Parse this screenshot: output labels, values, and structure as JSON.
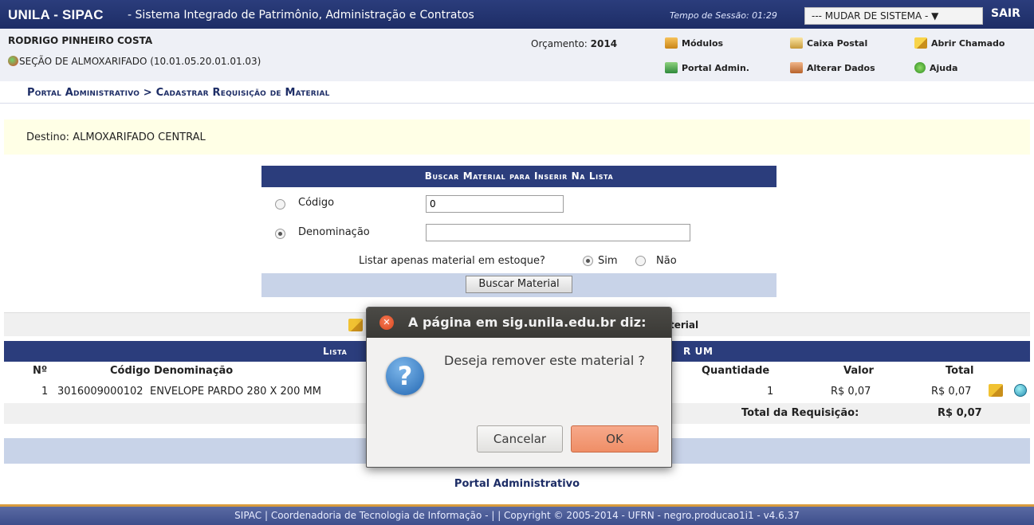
{
  "topbar": {
    "app_name": "UNILA - SIPAC",
    "subtitle": "- Sistema Integrado de Patrimônio, Administração e Contratos",
    "session_time": "Tempo de Sessão: 01:29",
    "system_switch": "--- MUDAR DE SISTEMA - ▼",
    "logout": "SAIR"
  },
  "user": {
    "name": "RODRIGO PINHEIRO COSTA",
    "section": "SEÇÃO DE ALMOXARIFADO (10.01.05.20.01.01.03)",
    "budget_label": "Orçamento:",
    "budget_year": "2014"
  },
  "menu": {
    "modulos": "Módulos",
    "caixa_postal": "Caixa Postal",
    "abrir_chamado": "Abrir Chamado",
    "portal_admin": "Portal Admin.",
    "alterar_dados": "Alterar Dados",
    "ajuda": "Ajuda"
  },
  "breadcrumb": "Portal Administrativo > Cadastrar Requisição de Material",
  "destination": "Destino: ALMOXARIFADO CENTRAL",
  "search": {
    "caption": "Buscar Material para Inserir Na Lista",
    "code_label": "Código",
    "code_value": "0",
    "name_label": "Denominação",
    "name_value": "",
    "stock_question": "Listar apenas material em estoque?",
    "yes": "Sim",
    "no": "Não",
    "button": "Buscar Material"
  },
  "add_bar_text": "terial",
  "list": {
    "caption_left": "Lista",
    "caption_right": "R UM",
    "headers": {
      "num": "Nº",
      "code_name": "Código Denominação",
      "qty": "Quantidade",
      "value": "Valor",
      "total": "Total"
    },
    "rows": [
      {
        "num": "1",
        "code": "3016009000102",
        "name": "ENVELOPE PARDO 280 X 200 MM",
        "qty": "1",
        "value": "R$ 0,07",
        "total": "R$ 0,07"
      }
    ],
    "total_label": "Total da Requisição:",
    "total_value": "R$ 0,07"
  },
  "portal_link": "Portal Administrativo",
  "footer": "SIPAC | Coordenadoria de Tecnologia de Informação - | | Copyright © 2005-2014 - UFRN - negro.producao1i1 - v4.6.37",
  "dialog": {
    "title": "A página em sig.unila.edu.br diz:",
    "message": "Deseja remover este material ?",
    "cancel": "Cancelar",
    "ok": "OK"
  }
}
